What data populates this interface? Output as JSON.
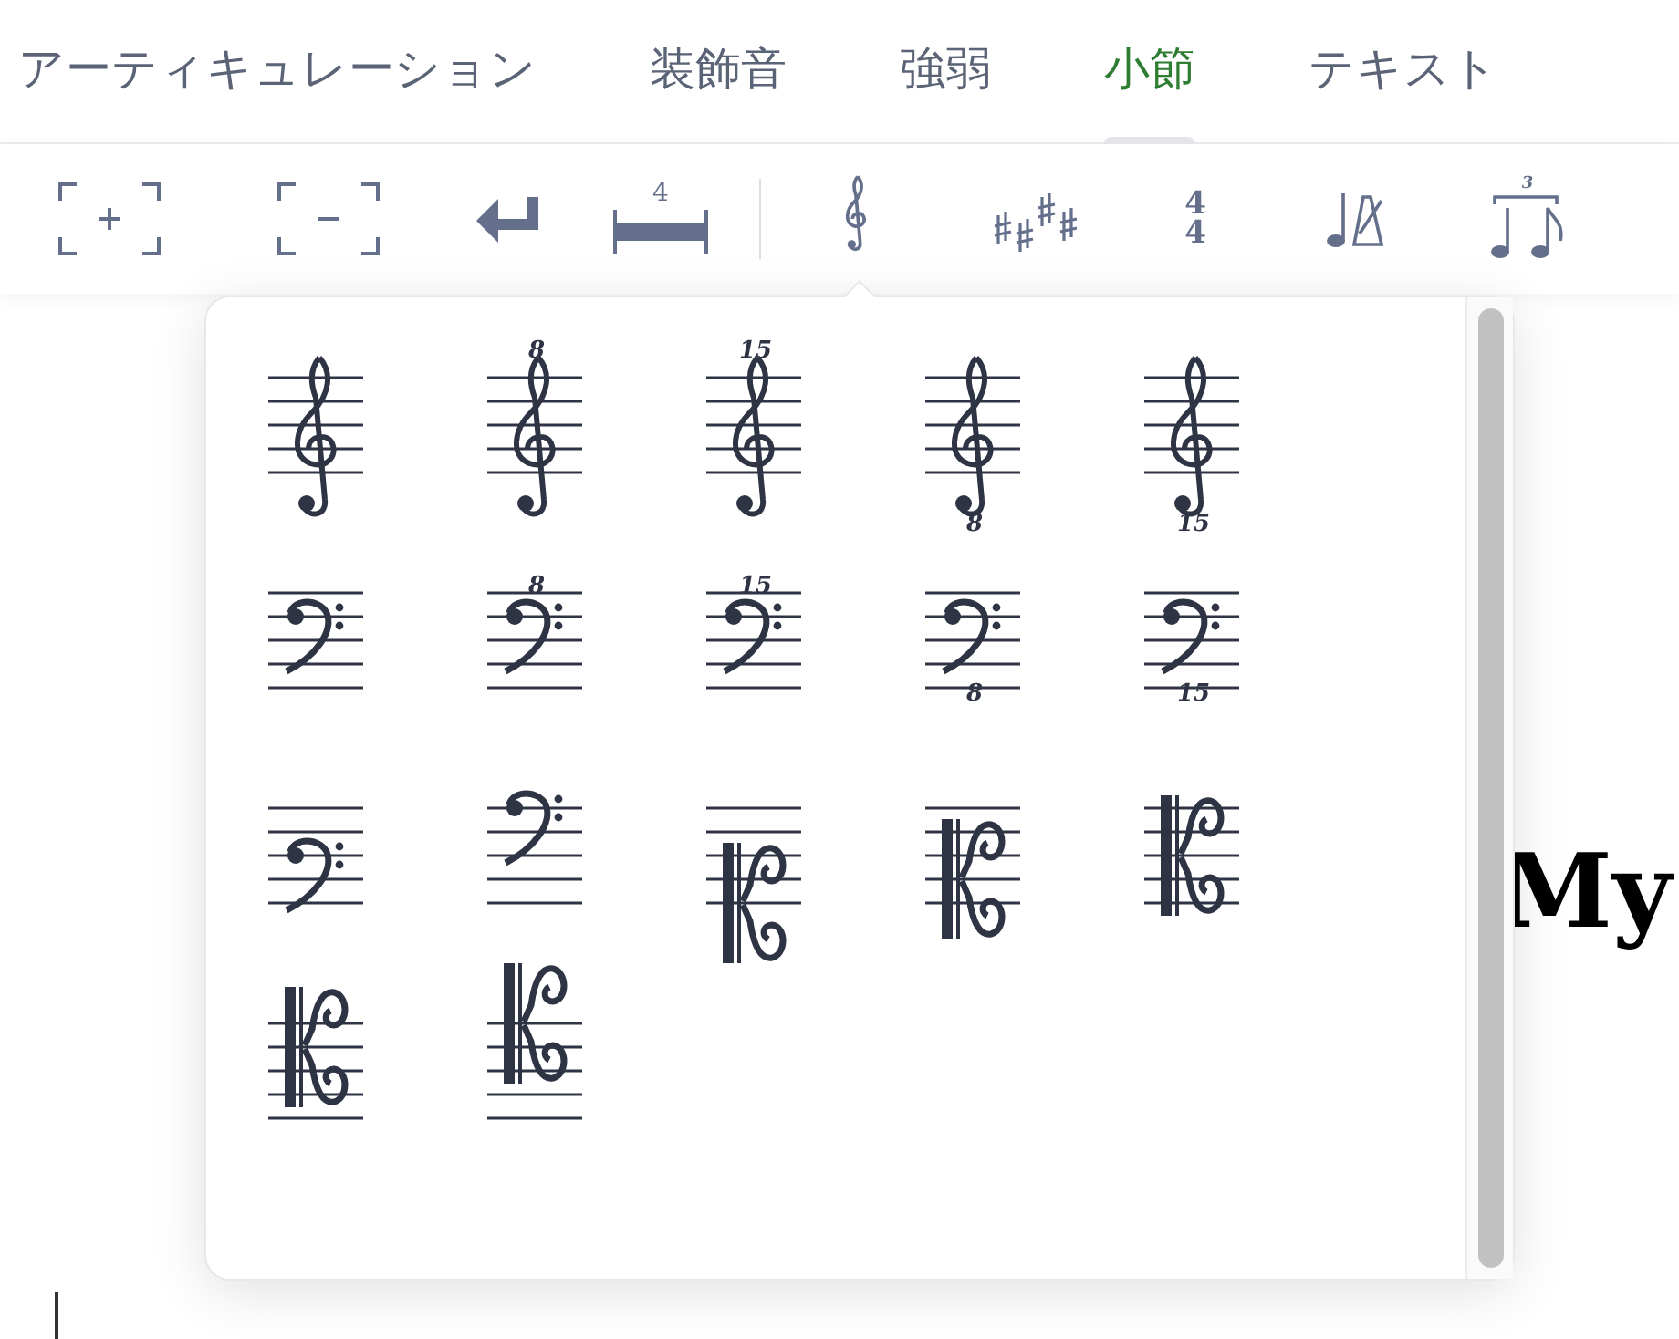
{
  "tabs": [
    {
      "label": "アーティキュレーション",
      "selected": false
    },
    {
      "label": "装飾音",
      "selected": false
    },
    {
      "label": "強弱",
      "selected": false
    },
    {
      "label": "小節",
      "selected": true
    },
    {
      "label": "テキスト",
      "selected": false
    }
  ],
  "toolbar": [
    {
      "kind": "add-measure"
    },
    {
      "kind": "remove-measure"
    },
    {
      "kind": "line-break"
    },
    {
      "kind": "multi-rest",
      "text": "4"
    },
    {
      "kind": "separator"
    },
    {
      "kind": "clef",
      "selected": true
    },
    {
      "kind": "key-signature"
    },
    {
      "kind": "time-signature",
      "text": "4",
      "text2": "4"
    },
    {
      "kind": "tempo"
    },
    {
      "kind": "tuplet",
      "text": "3"
    }
  ],
  "clefs": [
    {
      "kind": "treble"
    },
    {
      "kind": "treble-octave-above",
      "octave": "8"
    },
    {
      "kind": "treble-octave-above",
      "octave": "15"
    },
    {
      "kind": "treble-octave-below",
      "octave": "8"
    },
    {
      "kind": "treble-octave-below",
      "octave": "15"
    },
    {
      "kind": "bass"
    },
    {
      "kind": "bass-octave-above",
      "octave": "8"
    },
    {
      "kind": "bass-octave-above",
      "octave": "15"
    },
    {
      "kind": "bass-octave-below",
      "octave": "8"
    },
    {
      "kind": "bass-octave-below",
      "octave": "15"
    },
    {
      "kind": "baritone-f"
    },
    {
      "kind": "subbass"
    },
    {
      "kind": "c-bottom-line"
    },
    {
      "kind": "c-fourth-line"
    },
    {
      "kind": "alto"
    },
    {
      "kind": "tenor"
    },
    {
      "kind": "baritone-c"
    }
  ],
  "score_title": "My"
}
